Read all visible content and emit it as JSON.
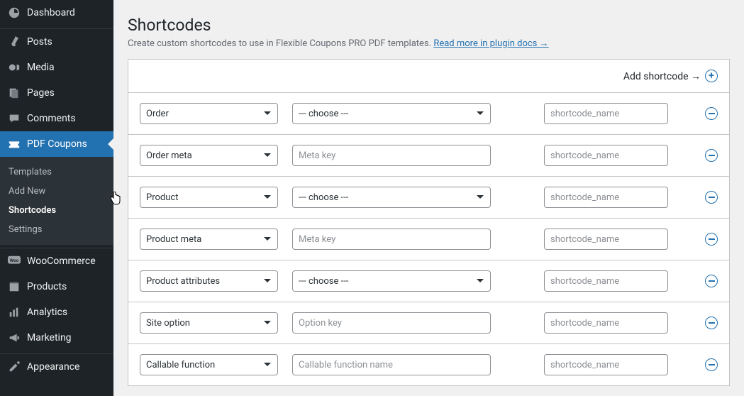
{
  "sidebar": {
    "items": [
      {
        "label": "Dashboard"
      },
      {
        "label": "Posts"
      },
      {
        "label": "Media"
      },
      {
        "label": "Pages"
      },
      {
        "label": "Comments"
      },
      {
        "label": "PDF Coupons"
      },
      {
        "label": "WooCommerce"
      },
      {
        "label": "Products"
      },
      {
        "label": "Analytics"
      },
      {
        "label": "Marketing"
      },
      {
        "label": "Appearance"
      }
    ],
    "submenu": [
      {
        "label": "Templates"
      },
      {
        "label": "Add New"
      },
      {
        "label": "Shortcodes"
      },
      {
        "label": "Settings"
      }
    ]
  },
  "page": {
    "title": "Shortcodes",
    "desc_text": "Create custom shortcodes to use in Flexible Coupons PRO PDF templates. ",
    "desc_link": "Read more in plugin docs →",
    "add_label": "Add shortcode →"
  },
  "rows": [
    {
      "type": "Order",
      "mode": "select",
      "second": "--- choose ---",
      "name_ph": "shortcode_name"
    },
    {
      "type": "Order meta",
      "mode": "text",
      "second_ph": "Meta key",
      "name_ph": "shortcode_name"
    },
    {
      "type": "Product",
      "mode": "select",
      "second": "--- choose ---",
      "name_ph": "shortcode_name"
    },
    {
      "type": "Product meta",
      "mode": "text",
      "second_ph": "Meta key",
      "name_ph": "shortcode_name"
    },
    {
      "type": "Product attributes",
      "mode": "select",
      "second": "--- choose ---",
      "name_ph": "shortcode_name"
    },
    {
      "type": "Site option",
      "mode": "text",
      "second_ph": "Option key",
      "name_ph": "shortcode_name"
    },
    {
      "type": "Callable function",
      "mode": "text",
      "second_ph": "Callable function name",
      "name_ph": "shortcode_name"
    }
  ]
}
